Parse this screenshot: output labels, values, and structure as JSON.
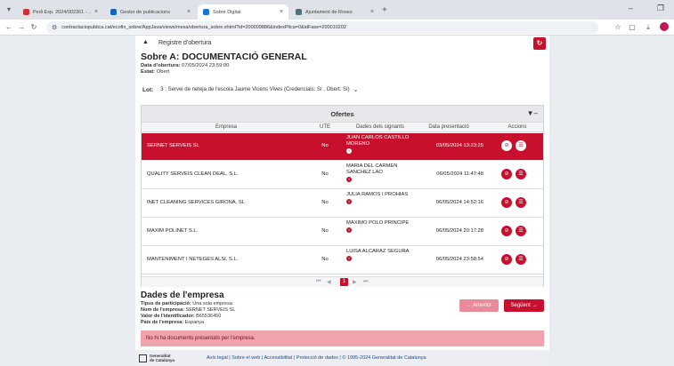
{
  "browser": {
    "tabs": [
      {
        "label": "Pedi Exp. 2024/002361 - ... ",
        "active": false,
        "color": "#d32f2f"
      },
      {
        "label": "Gestor de publicacions",
        "active": false,
        "color": "#1565c0"
      },
      {
        "label": "Sobre Digital",
        "active": true,
        "color": "#1976d2"
      },
      {
        "label": "Ajuntament de Roses",
        "active": false,
        "color": "#546e7a"
      }
    ],
    "url": "contractaciopublica.cat/ecofin_sobre/AppJava/views/mesa/obertura_sobre.xhtml?id=200009886&indexPlica=0&idFase=200010202"
  },
  "header": {
    "register_label": "Registre d'obertura",
    "title": "Sobre A: DOCUMENTACIÓ GENERAL",
    "opening_label": "Data d'obertura:",
    "opening_value": "07/05/2024 23:59:00",
    "status_label": "Estat:",
    "status_value": "Obert"
  },
  "lot": {
    "label": "Lot:",
    "selected": "3 : Servei de neteja de l'escola Jaume Vicens Vives (Credencials: Sí , Obert: Sí)"
  },
  "ofertes": {
    "title": "Ofertes",
    "columns": [
      "Empresa",
      "UTE",
      "Dades dels signants",
      "Data presentació",
      "Accions"
    ],
    "rows": [
      {
        "empresa": "SERNET SERVEIS SL",
        "ute": "No",
        "signant": "JUAN CARLOS CASTILLO MORENO",
        "data": "03/05/2024 13:23:25",
        "selected": true
      },
      {
        "empresa": "QUALITY SERVEIS CLEAN DEAL, S.L.",
        "ute": "No",
        "signant": "MARIA DEL CARMEN SANCHEZ LAO",
        "data": "06/05/2024 11:47:48",
        "selected": false
      },
      {
        "empresa": "INET CLEANING SERVICES GIRONA, SL",
        "ute": "No",
        "signant": "JULIA RAMOS I PROHIAS",
        "data": "06/05/2024 14:52:16",
        "selected": false
      },
      {
        "empresa": "MAXIM POLINET S.L.",
        "ute": "No",
        "signant": "MAXIMO POLO PRINCIPE",
        "data": "06/05/2024 20:17:28",
        "selected": false
      },
      {
        "empresa": "MANTENIMENT I NETEGES ALSI, S.L.",
        "ute": "No",
        "signant": "LUISA ALCARAZ SEGURA",
        "data": "06/05/2024 23:58:54",
        "selected": false
      }
    ],
    "pager": {
      "current": "1"
    }
  },
  "empresa": {
    "title": "Dades de l'empresa",
    "tipus_label": "Tipus de participació:",
    "tipus_value": "Una sola empresa",
    "nom_label": "Nom de l'empresa:",
    "nom_value": "SERNET SERVEIS SL",
    "id_label": "Valor de l'identificador:",
    "id_value": "B65536450",
    "pais_label": "País de l'empresa:",
    "pais_value": "Espanya"
  },
  "nav": {
    "prev": "Anterior",
    "next": "Següent"
  },
  "alert": "No hi ha documents presentats per l'empresa.",
  "footer": {
    "logo_line1": "Generalitat",
    "logo_line2": "de Catalunya",
    "links": "Avís legal | Sobre el web | Accessibilitat | Protecció de dades | © 1995-2024 Generalitat de Catalunya"
  },
  "colors": {
    "accent": "#c8102e"
  }
}
